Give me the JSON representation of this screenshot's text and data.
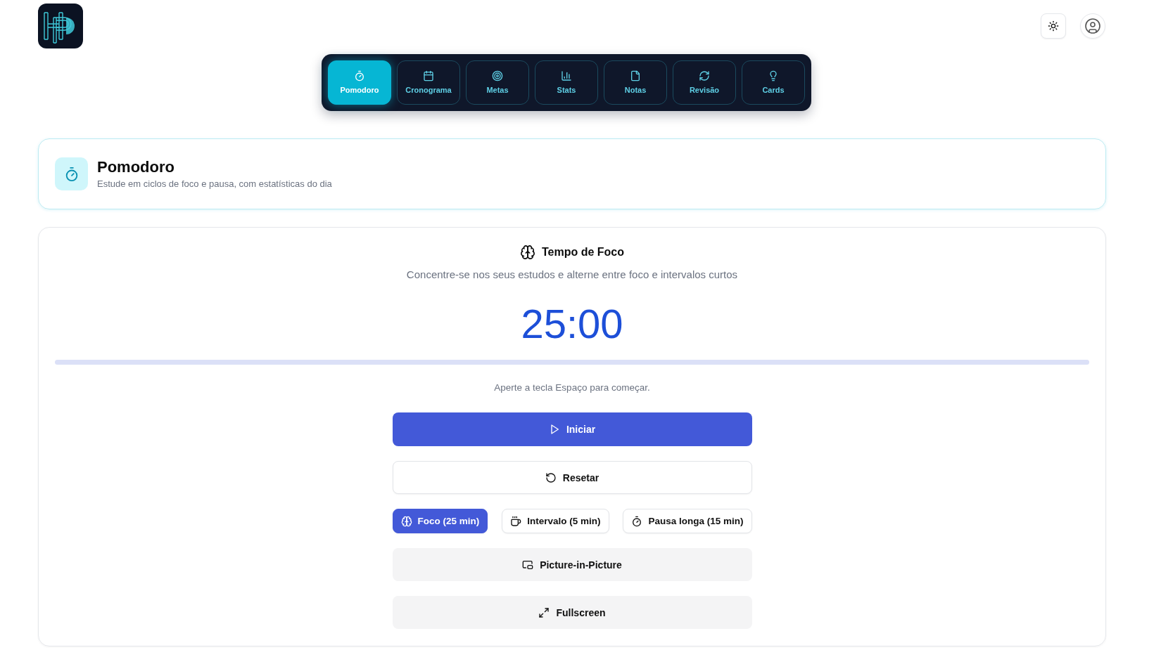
{
  "tabs": [
    {
      "label": "Pomodoro",
      "selected": true
    },
    {
      "label": "Cronograma",
      "selected": false
    },
    {
      "label": "Metas",
      "selected": false
    },
    {
      "label": "Stats",
      "selected": false
    },
    {
      "label": "Notas",
      "selected": false
    },
    {
      "label": "Revisão",
      "selected": false
    },
    {
      "label": "Cards",
      "selected": false
    }
  ],
  "page_header": {
    "title": "Pomodoro",
    "subtitle": "Estude em ciclos de foco e pausa, com estatísticas do dia"
  },
  "timer_card": {
    "title": "Tempo de Foco",
    "description": "Concentre-se nos seus estudos e alterne entre foco e intervalos curtos",
    "time": "25:00",
    "hint": "Aperte a tecla Espaço para começar.",
    "start_button": "Iniciar",
    "reset_button": "Resetar",
    "modes": [
      {
        "label": "Foco (25 min)",
        "selected": true
      },
      {
        "label": "Intervalo (5 min)",
        "selected": false
      },
      {
        "label": "Pausa longa (15 min)",
        "selected": false
      }
    ],
    "pip_button": "Picture-in-Picture",
    "fullscreen_button": "Fullscreen"
  }
}
